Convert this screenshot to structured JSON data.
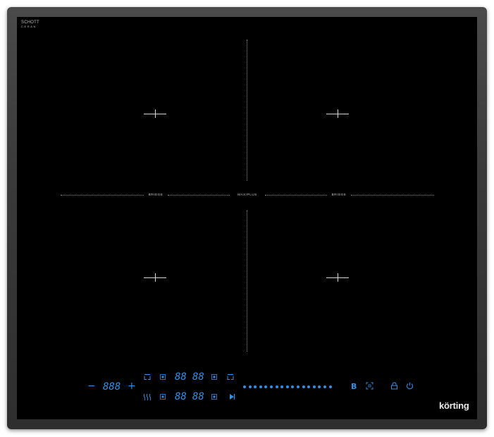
{
  "hob": {
    "maker_mark": {
      "line1": "SCHOTT",
      "line2": "CERAN"
    },
    "zone_labels": {
      "left_bridge": "BRIDGE",
      "center_bridge": "MAXIPLUS",
      "right_bridge": "BRIDGE"
    },
    "brand": "körting",
    "accent_color": "#2f8ee6",
    "glass_color": "#000000",
    "frame_color": "#3a3a3a"
  },
  "controls": {
    "minus": "−",
    "plus": "+",
    "timer_display": "888",
    "top_left_pair": "88",
    "top_right_pair": "88",
    "bottom_left_pair": "88",
    "bottom_right_pair": "88",
    "boost": "B",
    "slider_dot_count": 17,
    "icons": {
      "top_left_zone_select": "zone-select-icon",
      "top_right_zone_select": "zone-select-icon",
      "heat_icon": "heat-waves-icon",
      "play_icon": "play-pause-icon",
      "fullscreen_icon": "bridge-mode-icon",
      "lock_icon": "lock-icon",
      "power_icon": "power-icon"
    }
  }
}
